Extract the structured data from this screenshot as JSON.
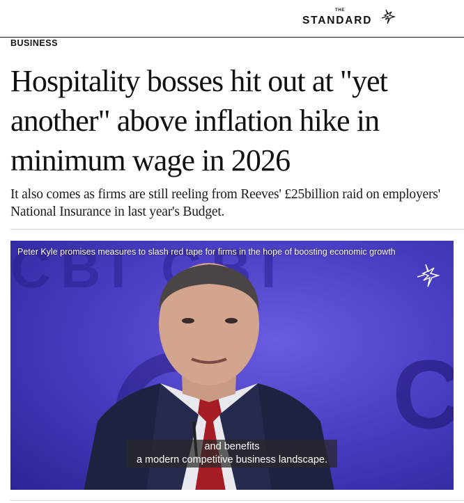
{
  "masthead": {
    "logo_small": "THE",
    "logo_main": "STANDARD"
  },
  "article": {
    "section": "BUSINESS",
    "headline": "Hospitality bosses hit out at \"yet another\" above inflation hike in minimum wage in 2026",
    "standfirst": "It also comes as firms are still reeling from Reeves' £25billion raid on employers' National Insurance in last year's Budget."
  },
  "video": {
    "title": "Peter Kyle promises measures to slash red tape for firms in the hope of boosting economic growth",
    "caption_line_1": "and benefits",
    "caption_line_2": "a modern competitive business landscape.",
    "background_text": "CBI CBI",
    "background_letter": "C"
  },
  "colors": {
    "video_background": "#4b3fc4",
    "text": "#111111"
  }
}
